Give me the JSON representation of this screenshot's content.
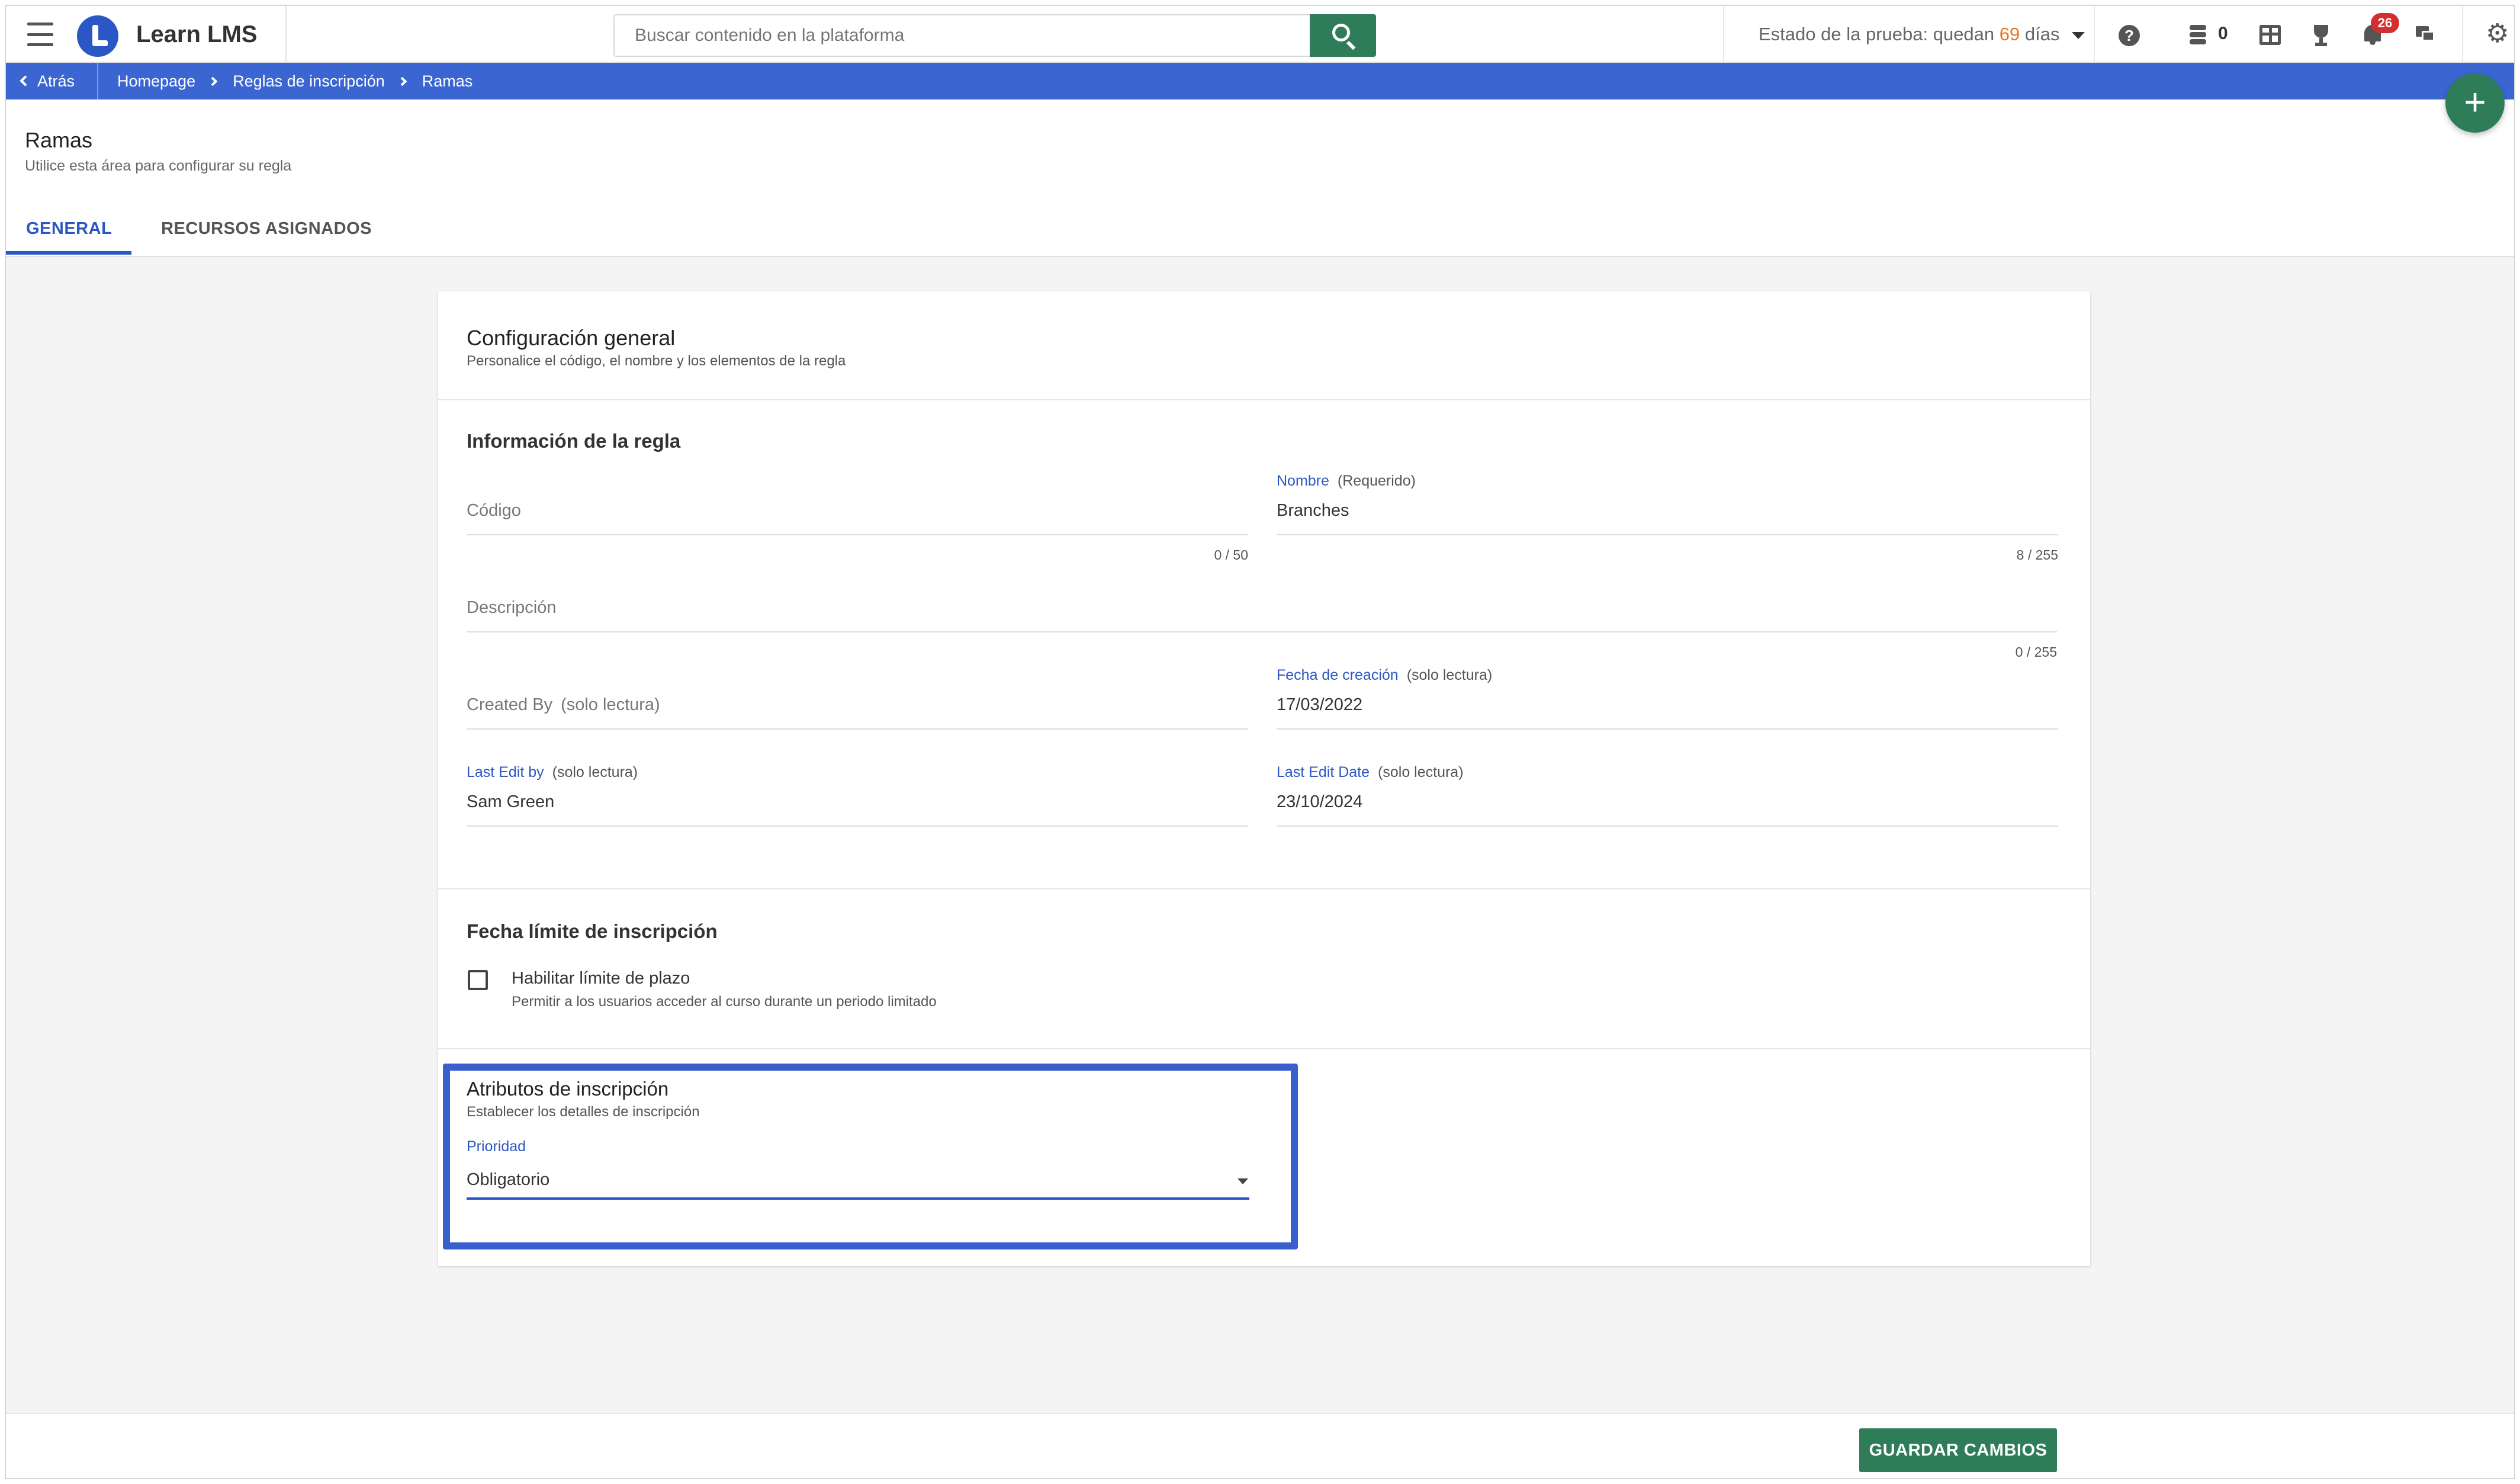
{
  "app": {
    "title": "Learn LMS"
  },
  "search": {
    "placeholder": "Buscar contenido en la plataforma"
  },
  "trial": {
    "prefix": "Estado de la prueba: quedan",
    "days": "69",
    "suffix": "días"
  },
  "header_icons": {
    "coins_count": "0",
    "notifications_count": "26"
  },
  "breadcrumb": {
    "back": "Atrás",
    "items": [
      "Homepage",
      "Reglas de inscripción",
      "Ramas"
    ]
  },
  "page": {
    "title": "Ramas",
    "subtitle": "Utilice esta área para configurar su regla"
  },
  "tabs": [
    {
      "label": "GENERAL",
      "active": true
    },
    {
      "label": "RECURSOS ASIGNADOS",
      "active": false
    }
  ],
  "card": {
    "title": "Configuración general",
    "subtitle": "Personalice el código, el nombre y los elementos de la regla",
    "rule_info": {
      "heading": "Información de la regla",
      "codigo": {
        "placeholder": "Código",
        "counter": "0 / 50"
      },
      "nombre": {
        "label": "Nombre",
        "tag": "(Requerido)",
        "value": "Branches",
        "counter": "8 / 255"
      },
      "descripcion": {
        "placeholder": "Descripción",
        "counter": "0 / 255"
      },
      "created_by": {
        "placeholder": "Created By",
        "tag": "(solo lectura)"
      },
      "fecha_creacion": {
        "label": "Fecha de creación",
        "tag": "(solo lectura)",
        "value": "17/03/2022"
      },
      "last_edit_by": {
        "label": "Last Edit by",
        "tag": "(solo lectura)",
        "value": "Sam Green"
      },
      "last_edit_date": {
        "label": "Last Edit Date",
        "tag": "(solo lectura)",
        "value": "23/10/2024"
      }
    },
    "deadline": {
      "heading": "Fecha límite de inscripción",
      "checkbox_label": "Habilitar límite de plazo",
      "checkbox_sub": "Permitir a los usuarios acceder al curso durante un periodo limitado",
      "checked": false
    },
    "attributes": {
      "heading": "Atributos de inscripción",
      "subtitle": "Establecer los detalles de inscripción",
      "priority_label": "Prioridad",
      "priority_value": "Obligatorio"
    }
  },
  "footer": {
    "save_label": "GUARDAR CAMBIOS"
  },
  "colors": {
    "brand_blue": "#3b66d1",
    "action_green": "#2e7d58",
    "accent_orange": "#e87722",
    "badge_red": "#d32f2f"
  }
}
